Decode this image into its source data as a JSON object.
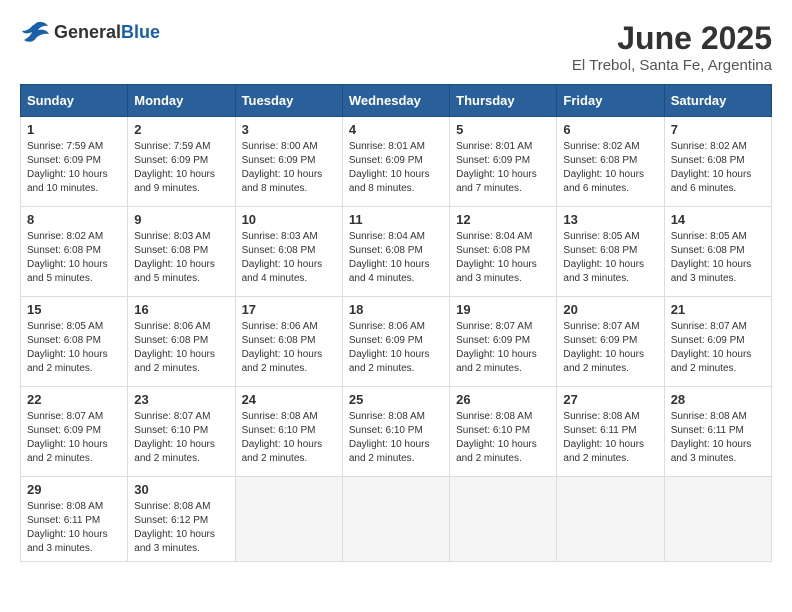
{
  "logo": {
    "general": "General",
    "blue": "Blue"
  },
  "title": "June 2025",
  "location": "El Trebol, Santa Fe, Argentina",
  "weekdays": [
    "Sunday",
    "Monday",
    "Tuesday",
    "Wednesday",
    "Thursday",
    "Friday",
    "Saturday"
  ],
  "weeks": [
    [
      {
        "day": "1",
        "info": "Sunrise: 7:59 AM\nSunset: 6:09 PM\nDaylight: 10 hours\nand 10 minutes."
      },
      {
        "day": "2",
        "info": "Sunrise: 7:59 AM\nSunset: 6:09 PM\nDaylight: 10 hours\nand 9 minutes."
      },
      {
        "day": "3",
        "info": "Sunrise: 8:00 AM\nSunset: 6:09 PM\nDaylight: 10 hours\nand 8 minutes."
      },
      {
        "day": "4",
        "info": "Sunrise: 8:01 AM\nSunset: 6:09 PM\nDaylight: 10 hours\nand 8 minutes."
      },
      {
        "day": "5",
        "info": "Sunrise: 8:01 AM\nSunset: 6:09 PM\nDaylight: 10 hours\nand 7 minutes."
      },
      {
        "day": "6",
        "info": "Sunrise: 8:02 AM\nSunset: 6:08 PM\nDaylight: 10 hours\nand 6 minutes."
      },
      {
        "day": "7",
        "info": "Sunrise: 8:02 AM\nSunset: 6:08 PM\nDaylight: 10 hours\nand 6 minutes."
      }
    ],
    [
      {
        "day": "8",
        "info": "Sunrise: 8:02 AM\nSunset: 6:08 PM\nDaylight: 10 hours\nand 5 minutes."
      },
      {
        "day": "9",
        "info": "Sunrise: 8:03 AM\nSunset: 6:08 PM\nDaylight: 10 hours\nand 5 minutes."
      },
      {
        "day": "10",
        "info": "Sunrise: 8:03 AM\nSunset: 6:08 PM\nDaylight: 10 hours\nand 4 minutes."
      },
      {
        "day": "11",
        "info": "Sunrise: 8:04 AM\nSunset: 6:08 PM\nDaylight: 10 hours\nand 4 minutes."
      },
      {
        "day": "12",
        "info": "Sunrise: 8:04 AM\nSunset: 6:08 PM\nDaylight: 10 hours\nand 3 minutes."
      },
      {
        "day": "13",
        "info": "Sunrise: 8:05 AM\nSunset: 6:08 PM\nDaylight: 10 hours\nand 3 minutes."
      },
      {
        "day": "14",
        "info": "Sunrise: 8:05 AM\nSunset: 6:08 PM\nDaylight: 10 hours\nand 3 minutes."
      }
    ],
    [
      {
        "day": "15",
        "info": "Sunrise: 8:05 AM\nSunset: 6:08 PM\nDaylight: 10 hours\nand 2 minutes."
      },
      {
        "day": "16",
        "info": "Sunrise: 8:06 AM\nSunset: 6:08 PM\nDaylight: 10 hours\nand 2 minutes."
      },
      {
        "day": "17",
        "info": "Sunrise: 8:06 AM\nSunset: 6:08 PM\nDaylight: 10 hours\nand 2 minutes."
      },
      {
        "day": "18",
        "info": "Sunrise: 8:06 AM\nSunset: 6:09 PM\nDaylight: 10 hours\nand 2 minutes."
      },
      {
        "day": "19",
        "info": "Sunrise: 8:07 AM\nSunset: 6:09 PM\nDaylight: 10 hours\nand 2 minutes."
      },
      {
        "day": "20",
        "info": "Sunrise: 8:07 AM\nSunset: 6:09 PM\nDaylight: 10 hours\nand 2 minutes."
      },
      {
        "day": "21",
        "info": "Sunrise: 8:07 AM\nSunset: 6:09 PM\nDaylight: 10 hours\nand 2 minutes."
      }
    ],
    [
      {
        "day": "22",
        "info": "Sunrise: 8:07 AM\nSunset: 6:09 PM\nDaylight: 10 hours\nand 2 minutes."
      },
      {
        "day": "23",
        "info": "Sunrise: 8:07 AM\nSunset: 6:10 PM\nDaylight: 10 hours\nand 2 minutes."
      },
      {
        "day": "24",
        "info": "Sunrise: 8:08 AM\nSunset: 6:10 PM\nDaylight: 10 hours\nand 2 minutes."
      },
      {
        "day": "25",
        "info": "Sunrise: 8:08 AM\nSunset: 6:10 PM\nDaylight: 10 hours\nand 2 minutes."
      },
      {
        "day": "26",
        "info": "Sunrise: 8:08 AM\nSunset: 6:10 PM\nDaylight: 10 hours\nand 2 minutes."
      },
      {
        "day": "27",
        "info": "Sunrise: 8:08 AM\nSunset: 6:11 PM\nDaylight: 10 hours\nand 2 minutes."
      },
      {
        "day": "28",
        "info": "Sunrise: 8:08 AM\nSunset: 6:11 PM\nDaylight: 10 hours\nand 3 minutes."
      }
    ],
    [
      {
        "day": "29",
        "info": "Sunrise: 8:08 AM\nSunset: 6:11 PM\nDaylight: 10 hours\nand 3 minutes."
      },
      {
        "day": "30",
        "info": "Sunrise: 8:08 AM\nSunset: 6:12 PM\nDaylight: 10 hours\nand 3 minutes."
      },
      {
        "day": "",
        "info": ""
      },
      {
        "day": "",
        "info": ""
      },
      {
        "day": "",
        "info": ""
      },
      {
        "day": "",
        "info": ""
      },
      {
        "day": "",
        "info": ""
      }
    ]
  ]
}
